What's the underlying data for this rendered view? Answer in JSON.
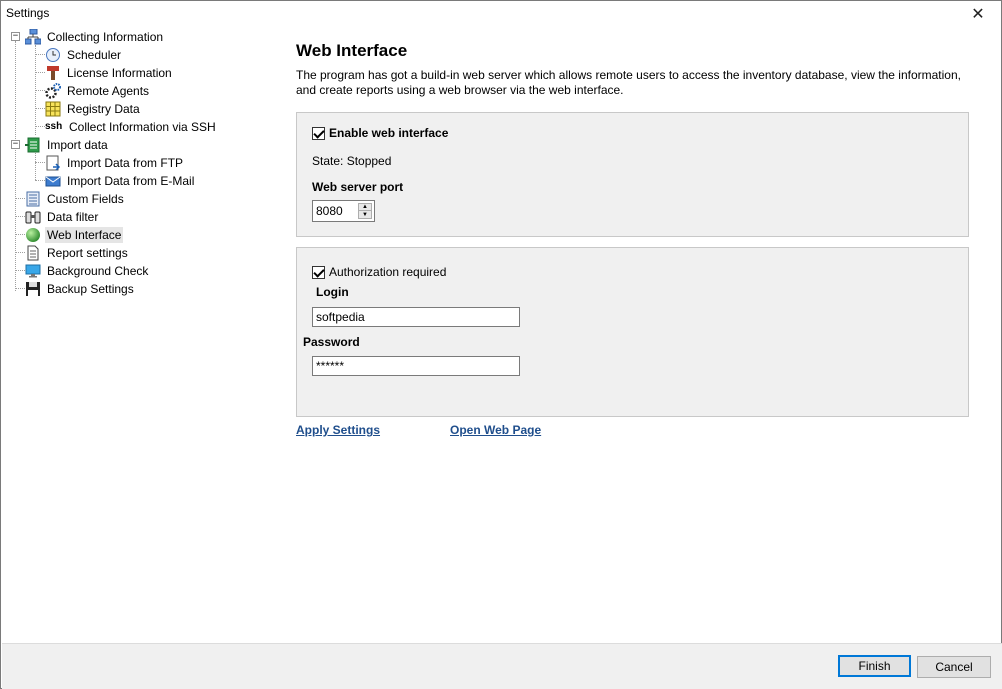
{
  "window": {
    "title": "Settings",
    "close_glyph": "✕"
  },
  "tree": {
    "items": [
      {
        "label": "Collecting Information",
        "icon": "network-icon"
      },
      {
        "label": "Scheduler",
        "icon": "clock-icon"
      },
      {
        "label": "License Information",
        "icon": "license-icon"
      },
      {
        "label": "Remote Agents",
        "icon": "gears-icon"
      },
      {
        "label": "Registry Data",
        "icon": "grid-icon"
      },
      {
        "label": "Collect Information via SSH",
        "icon": "ssh-icon",
        "prefix": "ssh"
      },
      {
        "label": "Import data",
        "icon": "import-icon"
      },
      {
        "label": "Import Data from FTP",
        "icon": "ftp-import-icon"
      },
      {
        "label": "Import Data from E-Mail",
        "icon": "mail-import-icon"
      },
      {
        "label": "Custom Fields",
        "icon": "list-icon"
      },
      {
        "label": "Data filter",
        "icon": "binoculars-icon"
      },
      {
        "label": "Web Interface",
        "icon": "globe-icon"
      },
      {
        "label": "Report settings",
        "icon": "report-icon"
      },
      {
        "label": "Background Check",
        "icon": "monitor-icon"
      },
      {
        "label": "Backup Settings",
        "icon": "floppy-icon"
      }
    ]
  },
  "main": {
    "title": "Web Interface",
    "description": "The program has got a build-in web server which allows remote users to access the inventory database, view the information, and create reports using a web browser via the web interface.",
    "server_panel": {
      "enable_label": "Enable web interface",
      "enable_checked": true,
      "state_text": "State: Stopped",
      "port_label": "Web server port",
      "port_value": "8080"
    },
    "auth_panel": {
      "auth_label": "Authorization required",
      "auth_checked": true,
      "login_label": "Login",
      "login_value": "softpedia",
      "password_label": "Password",
      "password_value": "******"
    },
    "links": {
      "apply": "Apply Settings",
      "open": "Open Web Page"
    }
  },
  "footer": {
    "finish_label": "Finish",
    "cancel_label": "Cancel"
  },
  "colors": {
    "link": "#1f4e8c",
    "default_button_border": "#0078d7",
    "panel_bg": "#f0f0f0"
  }
}
